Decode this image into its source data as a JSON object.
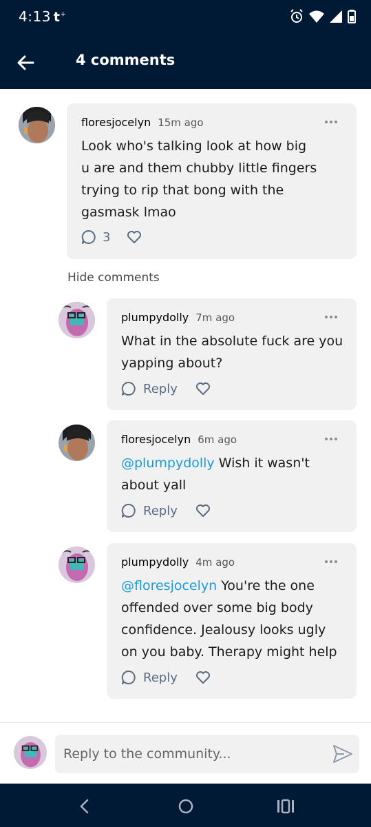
{
  "status_bar": {
    "time": "4:13",
    "carrier_glyph": "t",
    "icons": [
      "alarm-icon",
      "wifi-icon",
      "signal-icon",
      "battery-icon"
    ]
  },
  "header": {
    "title": "4 comments",
    "back_icon": "arrow-left-icon"
  },
  "colors": {
    "navy": "#001935",
    "bubble": "#f1f1f1",
    "mention": "#1a9bd7",
    "action": "#5a6b82"
  },
  "comments": [
    {
      "user": "floresjocelyn",
      "time": "15m ago",
      "lines": [
        "Look who's talking look at how big",
        "u are and them chubby little fingers",
        "trying to rip that bong with the",
        "gasmask lmao"
      ],
      "reply_count": "3"
    },
    {
      "user": "plumpydolly",
      "time": "7m ago",
      "lines": [
        "What in the absolute fuck are you",
        "yapping about?"
      ],
      "reply_label": "Reply"
    },
    {
      "user": "floresjocelyn",
      "time": "6m ago",
      "mention": "@plumpydolly",
      "lines": [
        " Wish it wasn't",
        "about yall"
      ],
      "reply_label": "Reply"
    },
    {
      "user": "plumpydolly",
      "time": "4m ago",
      "mention": "@floresjocelyn",
      "lines": [
        " You're the one",
        "offended over some big body",
        "confidence. Jealousy looks ugly",
        "on you baby. Therapy might help"
      ],
      "reply_label": "Reply"
    }
  ],
  "hide_comments_label": "Hide comments",
  "reply_bar": {
    "placeholder": "Reply to the community..."
  },
  "nav": {
    "icons": [
      "back-nav-icon",
      "home-nav-icon",
      "recents-nav-icon"
    ]
  }
}
